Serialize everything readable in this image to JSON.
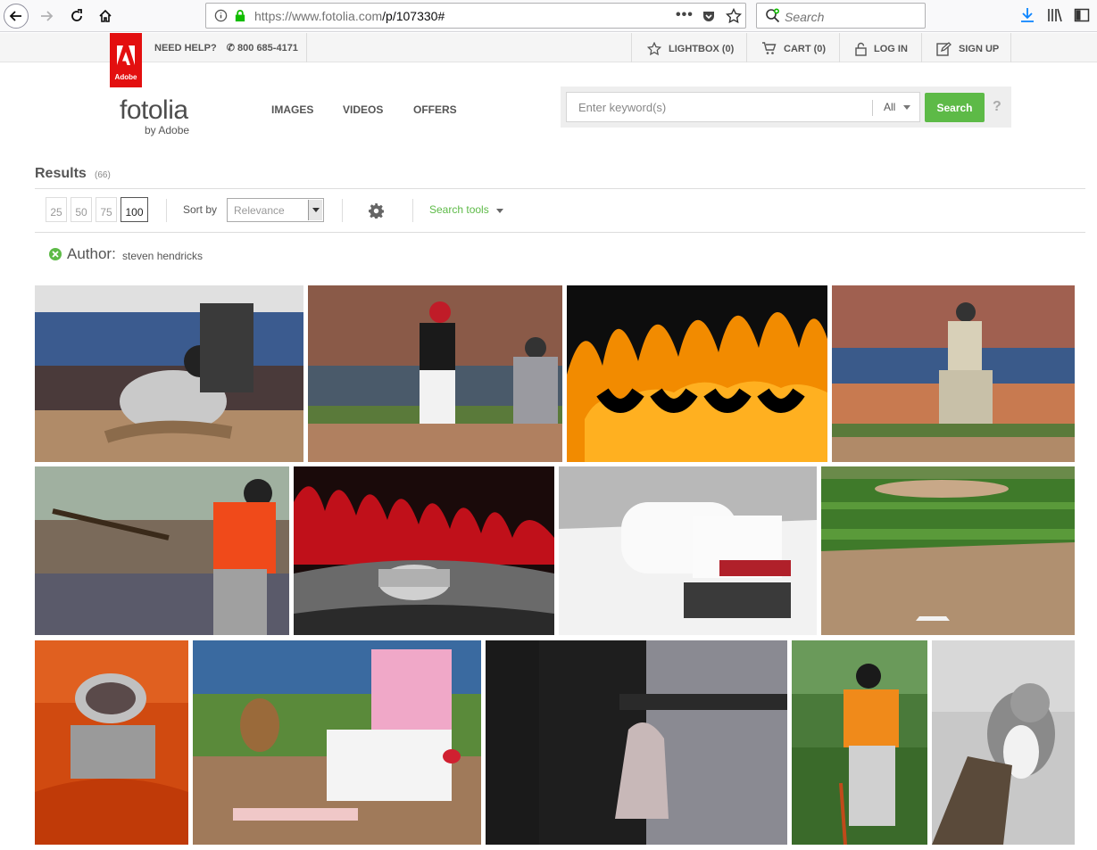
{
  "browser": {
    "url_host": "https://www.fotolia.com",
    "url_path": "/p/107330#",
    "search_placeholder": "Search"
  },
  "topbar": {
    "adobe_badge": "Adobe",
    "help_label": "NEED HELP?",
    "phone": "800 685-4171",
    "lightbox": "LIGHTBOX (0)",
    "cart": "CART (0)",
    "login": "LOG IN",
    "signup": "SIGN UP"
  },
  "header": {
    "logo": "fotolia",
    "logo_sub": "by Adobe",
    "nav": [
      "IMAGES",
      "VIDEOS",
      "OFFERS"
    ],
    "search_placeholder": "Enter keyword(s)",
    "category": "All",
    "search_button": "Search",
    "help": "?"
  },
  "results": {
    "title": "Results",
    "count": "(66)",
    "per_page": [
      "25",
      "50",
      "75",
      "100"
    ],
    "per_page_active": "100",
    "sort_label": "Sort by",
    "sort_value": "Relevance",
    "search_tools": "Search tools",
    "filter_label": "Author:",
    "filter_value": "steven hendricks"
  },
  "photos": [
    {
      "subject": "baseball player sliding into base"
    },
    {
      "subject": "batter swinging with catcher"
    },
    {
      "subject": "orange hot rod flames"
    },
    {
      "subject": "batter hitting ball in stadium"
    },
    {
      "subject": "batter in orange jersey"
    },
    {
      "subject": "red flames hot rod with chrome cap"
    },
    {
      "subject": "snow covered lawn tractor"
    },
    {
      "subject": "baseball infield pitcher mound"
    },
    {
      "subject": "orange hot rod engine"
    },
    {
      "subject": "player sliding into base pink"
    },
    {
      "subject": "umpire with glove in pocket"
    },
    {
      "subject": "player number 24 orange jersey"
    },
    {
      "subject": "squirrel in snow"
    }
  ],
  "colors": {
    "brand_green": "#5dba47",
    "adobe_red": "#e30f0f"
  }
}
